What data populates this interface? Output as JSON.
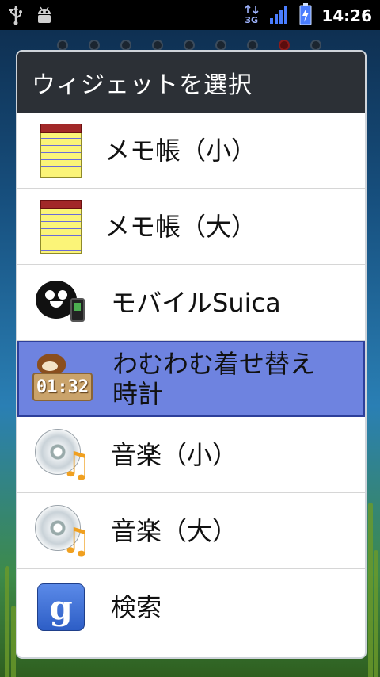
{
  "status_bar": {
    "time": "14:26",
    "network": "3G",
    "icons": [
      "usb-icon",
      "android-debug-icon",
      "3g-data-icon",
      "signal-strength-icon",
      "battery-charging-icon"
    ]
  },
  "home_screen": {
    "page_count": 9,
    "active_page": 8
  },
  "dialog": {
    "title": "ウィジェットを選択",
    "items": [
      {
        "label": "メモ帳（小）",
        "icon": "notepad-icon"
      },
      {
        "label": "メモ帳（大）",
        "icon": "notepad-icon"
      },
      {
        "label": "モバイルSuica",
        "icon": "suica-penguin-icon"
      },
      {
        "label": "わむわむ着せ替え時計",
        "icon": "clock-widget-icon",
        "clock_text": "01:32",
        "selected": true
      },
      {
        "label": "音楽（小）",
        "icon": "music-cd-icon"
      },
      {
        "label": "音楽（大）",
        "icon": "music-cd-icon"
      },
      {
        "label": "検索",
        "icon": "google-search-icon",
        "icon_text": "g"
      }
    ]
  },
  "colors": {
    "dialog_title_bg": "#2c3036",
    "selected_bg": "#6e83e0",
    "status_bar_bg": "#000000"
  }
}
